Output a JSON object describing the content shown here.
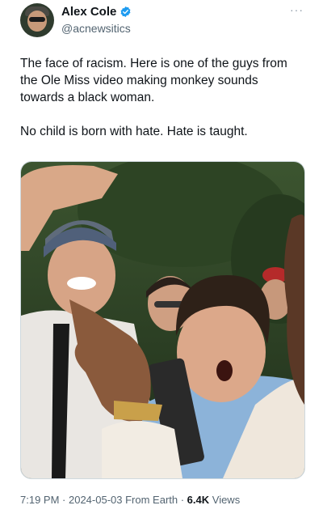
{
  "author": {
    "name": "Alex Cole",
    "handle": "@acnewsitics",
    "verified_color": "#1d9bf0"
  },
  "more_icon": "ellipsis-icon",
  "tweet": {
    "paragraph_1": "The face of racism. Here is one of the guys from the Ole Miss video making monkey sounds towards a black woman.",
    "paragraph_2": "No child is born with hate. Hate is taught."
  },
  "meta": {
    "time": "7:19 PM",
    "separator_1": " · ",
    "date": "2024-05-03",
    "source": " From Earth",
    "separator_2": " · ",
    "views": "6.4K",
    "views_label": " Views"
  }
}
